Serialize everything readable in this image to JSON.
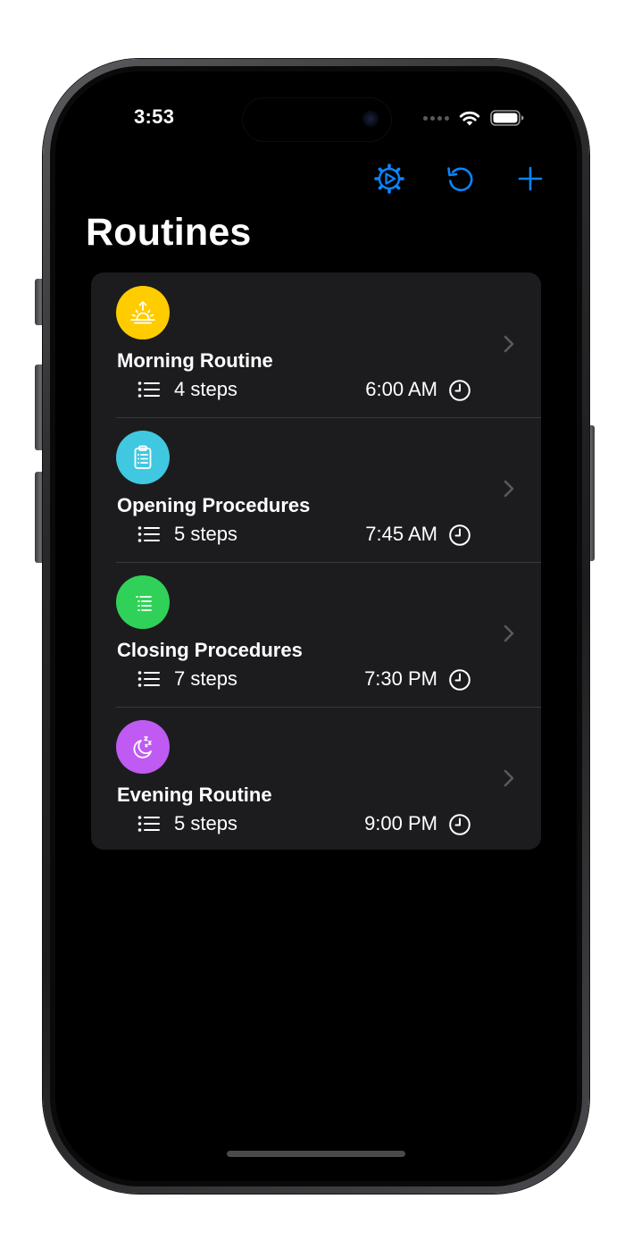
{
  "status_bar": {
    "time": "3:53",
    "icons": [
      "cellular-dots-icon",
      "wifi-icon",
      "battery-icon"
    ]
  },
  "toolbar": {
    "items": [
      {
        "icon": "gear-play-icon"
      },
      {
        "icon": "refresh-icon"
      },
      {
        "icon": "plus-icon"
      }
    ],
    "accent_color": "#0a84ff"
  },
  "page": {
    "title": "Routines"
  },
  "routines": [
    {
      "title": "Morning Routine",
      "steps": "4 steps",
      "time": "6:00 AM",
      "icon": "sunrise-icon",
      "color": "#ffcc00"
    },
    {
      "title": "Opening Procedures",
      "steps": "5 steps",
      "time": "7:45 AM",
      "icon": "clipboard-icon",
      "color": "#40c8e0"
    },
    {
      "title": "Closing Procedures",
      "steps": "7 steps",
      "time": "7:30 PM",
      "icon": "list-icon",
      "color": "#30d158"
    },
    {
      "title": "Evening Routine",
      "steps": "5 steps",
      "time": "9:00 PM",
      "icon": "moon-zzz-icon",
      "color": "#bf5af2"
    }
  ],
  "row_icons": {
    "steps": "list-bullet-icon",
    "time": "clock-icon",
    "disclosure": "chevron-right-icon"
  },
  "colors": {
    "background": "#000000",
    "card": "#1c1c1e",
    "separator": "#38383a",
    "chevron": "#5a5a5e"
  }
}
